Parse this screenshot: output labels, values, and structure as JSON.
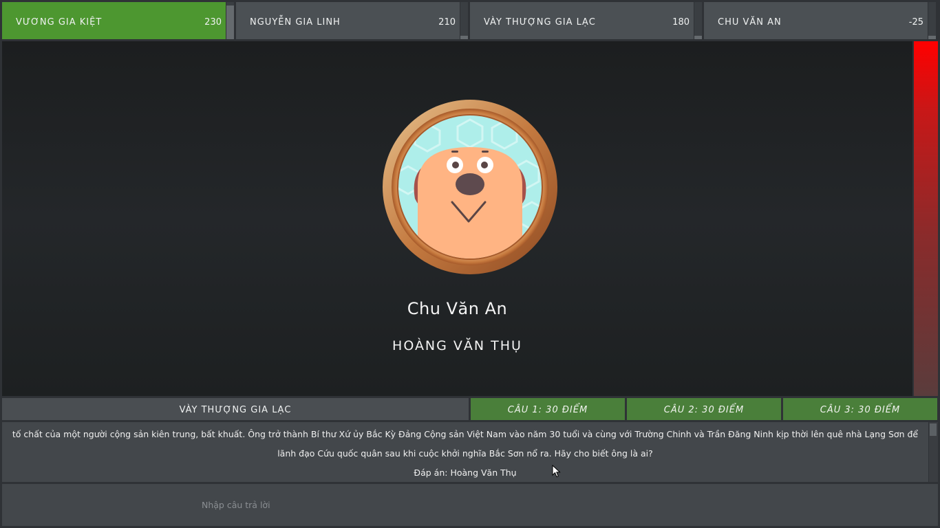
{
  "players": [
    {
      "name": "VƯƠNG GIA KIỆT",
      "score": "230",
      "active": true,
      "gauge": 0.9
    },
    {
      "name": "NGUYỄN GIA LINH",
      "score": "210",
      "active": false,
      "gauge": 0.1
    },
    {
      "name": "VÀY THƯỢNG GIA LẠC",
      "score": "180",
      "active": false,
      "gauge": 0.1
    },
    {
      "name": "CHU VĂN AN",
      "score": "-25",
      "active": false,
      "gauge": 0.1
    }
  ],
  "stage": {
    "presenter_name": "Chu Văn An",
    "answer_title": "HOÀNG VĂN THỤ",
    "timer_fraction": 1.0
  },
  "question_bar": {
    "current_player": "VÀY THƯỢNG GIA LẠC",
    "tabs": [
      {
        "label": "CÂU 1: 30 ĐIỂM"
      },
      {
        "label": "CÂU 2: 30 ĐIỂM"
      },
      {
        "label": "CÂU 3: 30 ĐIỂM"
      }
    ]
  },
  "question": {
    "text": "tố chất của một người cộng sản kiên trung, bất khuất. Ông trở thành Bí thư Xứ ủy Bắc Kỳ Đảng Cộng sản Việt Nam vào năm 30 tuổi và cùng với Trường Chinh và Trần Đăng Ninh kịp thời lên quê nhà Lạng Sơn để lãnh đạo Cứu quốc quân sau khi cuộc khởi nghĩa Bắc Sơn nổ ra. Hãy cho biết ông là ai?",
    "answer": "Đáp án: Hoàng Văn Thụ"
  },
  "input": {
    "placeholder": "Nhập câu trả lời",
    "value": ""
  },
  "colors": {
    "active_player": "#4d9730",
    "tab_green": "#4a7f3a",
    "timer_red": "#ff0000",
    "panel": "#43474b"
  },
  "icons": {
    "avatar": "dog-avatar-icon",
    "cursor": "mouse-pointer-icon"
  }
}
